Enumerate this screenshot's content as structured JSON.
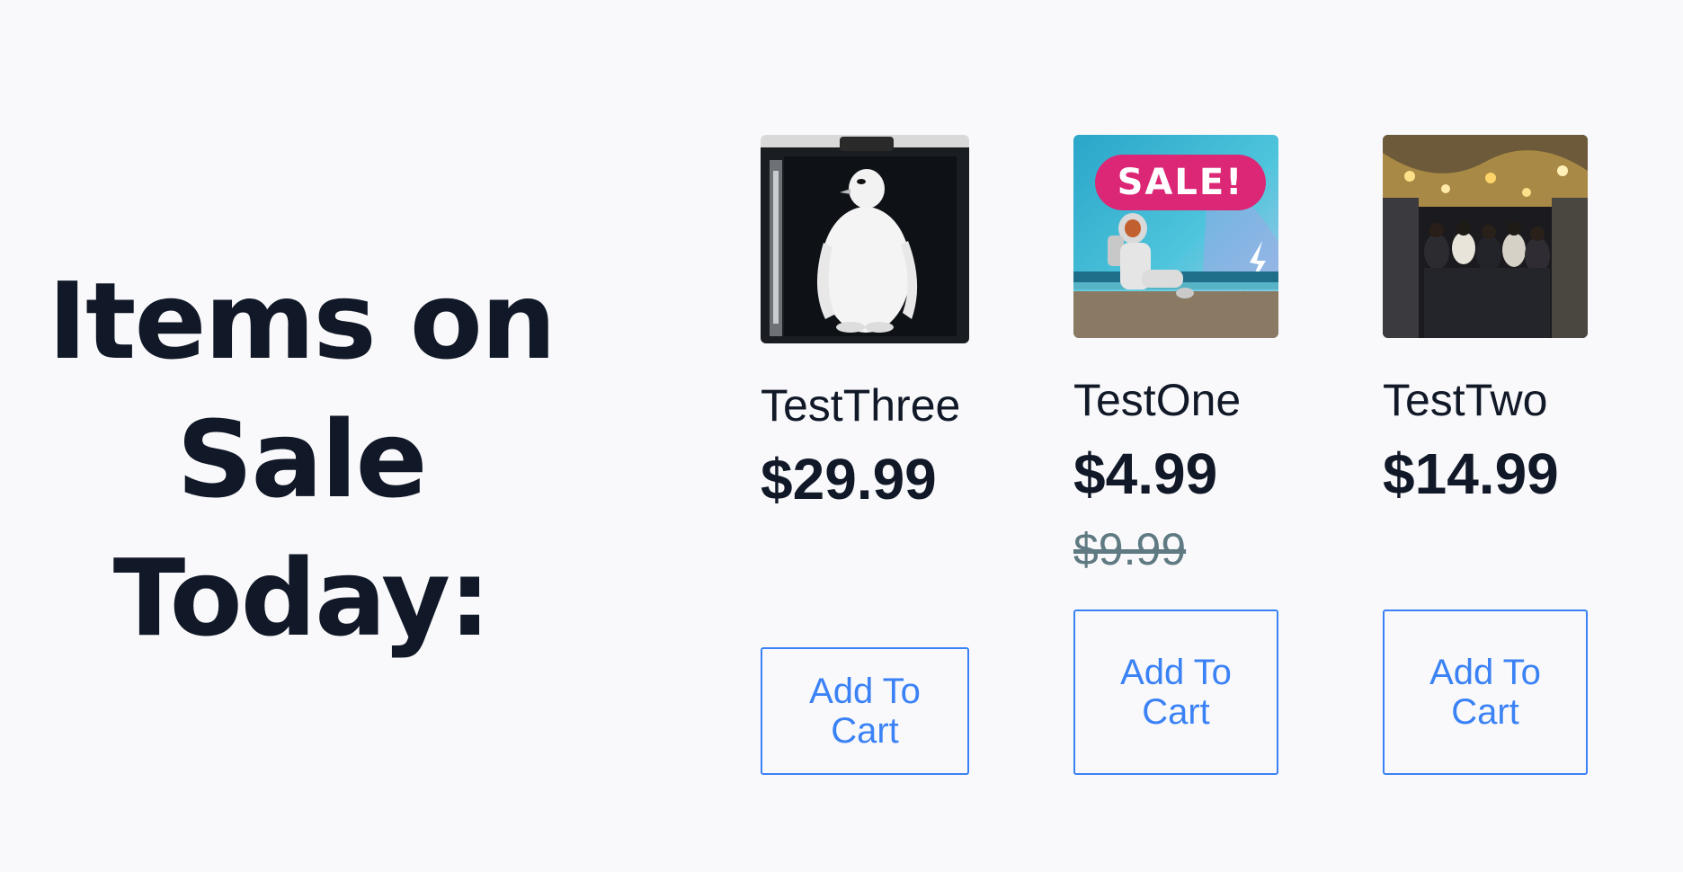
{
  "heading": "Items on Sale Today:",
  "products": [
    {
      "name": "TestThree",
      "price": "$29.99",
      "old_price": "",
      "button_label": "Add To Cart",
      "image_icon": "penguin-image"
    },
    {
      "name": "TestOne",
      "price": "$4.99",
      "old_price": "$9.99",
      "badge": "SALE!",
      "button_label": "Add To Cart",
      "image_icon": "astronaut-beach-image"
    },
    {
      "name": "TestTwo",
      "price": "$14.99",
      "old_price": "",
      "button_label": "Add To Cart",
      "image_icon": "night-market-image"
    }
  ],
  "colors": {
    "background": "#f9f9fb",
    "text": "#111827",
    "button_accent": "#3b82f6",
    "sale_badge": "#db2775",
    "old_price": "#5f7a82"
  }
}
